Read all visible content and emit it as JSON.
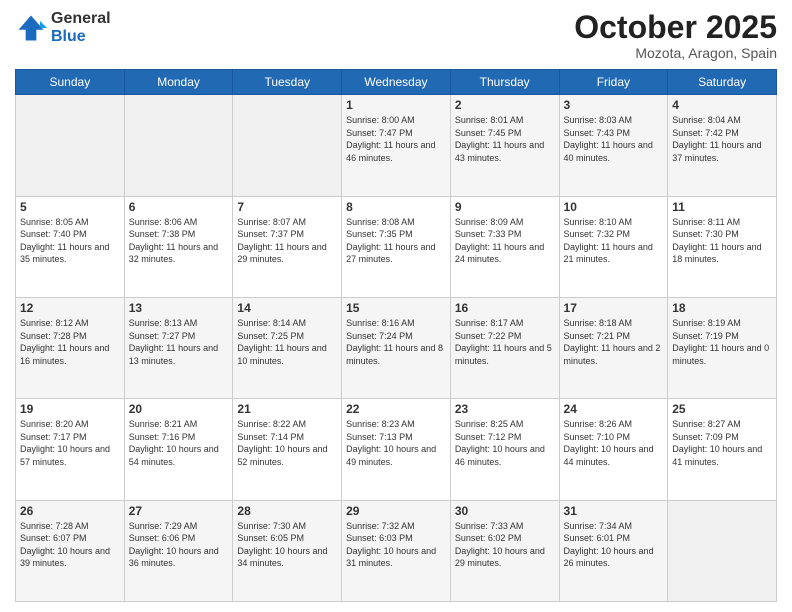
{
  "logo": {
    "general": "General",
    "blue": "Blue"
  },
  "title": "October 2025",
  "subtitle": "Mozota, Aragon, Spain",
  "days_of_week": [
    "Sunday",
    "Monday",
    "Tuesday",
    "Wednesday",
    "Thursday",
    "Friday",
    "Saturday"
  ],
  "weeks": [
    [
      {
        "day": "",
        "info": ""
      },
      {
        "day": "",
        "info": ""
      },
      {
        "day": "",
        "info": ""
      },
      {
        "day": "1",
        "info": "Sunrise: 8:00 AM\nSunset: 7:47 PM\nDaylight: 11 hours and 46 minutes."
      },
      {
        "day": "2",
        "info": "Sunrise: 8:01 AM\nSunset: 7:45 PM\nDaylight: 11 hours and 43 minutes."
      },
      {
        "day": "3",
        "info": "Sunrise: 8:03 AM\nSunset: 7:43 PM\nDaylight: 11 hours and 40 minutes."
      },
      {
        "day": "4",
        "info": "Sunrise: 8:04 AM\nSunset: 7:42 PM\nDaylight: 11 hours and 37 minutes."
      }
    ],
    [
      {
        "day": "5",
        "info": "Sunrise: 8:05 AM\nSunset: 7:40 PM\nDaylight: 11 hours and 35 minutes."
      },
      {
        "day": "6",
        "info": "Sunrise: 8:06 AM\nSunset: 7:38 PM\nDaylight: 11 hours and 32 minutes."
      },
      {
        "day": "7",
        "info": "Sunrise: 8:07 AM\nSunset: 7:37 PM\nDaylight: 11 hours and 29 minutes."
      },
      {
        "day": "8",
        "info": "Sunrise: 8:08 AM\nSunset: 7:35 PM\nDaylight: 11 hours and 27 minutes."
      },
      {
        "day": "9",
        "info": "Sunrise: 8:09 AM\nSunset: 7:33 PM\nDaylight: 11 hours and 24 minutes."
      },
      {
        "day": "10",
        "info": "Sunrise: 8:10 AM\nSunset: 7:32 PM\nDaylight: 11 hours and 21 minutes."
      },
      {
        "day": "11",
        "info": "Sunrise: 8:11 AM\nSunset: 7:30 PM\nDaylight: 11 hours and 18 minutes."
      }
    ],
    [
      {
        "day": "12",
        "info": "Sunrise: 8:12 AM\nSunset: 7:28 PM\nDaylight: 11 hours and 16 minutes."
      },
      {
        "day": "13",
        "info": "Sunrise: 8:13 AM\nSunset: 7:27 PM\nDaylight: 11 hours and 13 minutes."
      },
      {
        "day": "14",
        "info": "Sunrise: 8:14 AM\nSunset: 7:25 PM\nDaylight: 11 hours and 10 minutes."
      },
      {
        "day": "15",
        "info": "Sunrise: 8:16 AM\nSunset: 7:24 PM\nDaylight: 11 hours and 8 minutes."
      },
      {
        "day": "16",
        "info": "Sunrise: 8:17 AM\nSunset: 7:22 PM\nDaylight: 11 hours and 5 minutes."
      },
      {
        "day": "17",
        "info": "Sunrise: 8:18 AM\nSunset: 7:21 PM\nDaylight: 11 hours and 2 minutes."
      },
      {
        "day": "18",
        "info": "Sunrise: 8:19 AM\nSunset: 7:19 PM\nDaylight: 11 hours and 0 minutes."
      }
    ],
    [
      {
        "day": "19",
        "info": "Sunrise: 8:20 AM\nSunset: 7:17 PM\nDaylight: 10 hours and 57 minutes."
      },
      {
        "day": "20",
        "info": "Sunrise: 8:21 AM\nSunset: 7:16 PM\nDaylight: 10 hours and 54 minutes."
      },
      {
        "day": "21",
        "info": "Sunrise: 8:22 AM\nSunset: 7:14 PM\nDaylight: 10 hours and 52 minutes."
      },
      {
        "day": "22",
        "info": "Sunrise: 8:23 AM\nSunset: 7:13 PM\nDaylight: 10 hours and 49 minutes."
      },
      {
        "day": "23",
        "info": "Sunrise: 8:25 AM\nSunset: 7:12 PM\nDaylight: 10 hours and 46 minutes."
      },
      {
        "day": "24",
        "info": "Sunrise: 8:26 AM\nSunset: 7:10 PM\nDaylight: 10 hours and 44 minutes."
      },
      {
        "day": "25",
        "info": "Sunrise: 8:27 AM\nSunset: 7:09 PM\nDaylight: 10 hours and 41 minutes."
      }
    ],
    [
      {
        "day": "26",
        "info": "Sunrise: 7:28 AM\nSunset: 6:07 PM\nDaylight: 10 hours and 39 minutes."
      },
      {
        "day": "27",
        "info": "Sunrise: 7:29 AM\nSunset: 6:06 PM\nDaylight: 10 hours and 36 minutes."
      },
      {
        "day": "28",
        "info": "Sunrise: 7:30 AM\nSunset: 6:05 PM\nDaylight: 10 hours and 34 minutes."
      },
      {
        "day": "29",
        "info": "Sunrise: 7:32 AM\nSunset: 6:03 PM\nDaylight: 10 hours and 31 minutes."
      },
      {
        "day": "30",
        "info": "Sunrise: 7:33 AM\nSunset: 6:02 PM\nDaylight: 10 hours and 29 minutes."
      },
      {
        "day": "31",
        "info": "Sunrise: 7:34 AM\nSunset: 6:01 PM\nDaylight: 10 hours and 26 minutes."
      },
      {
        "day": "",
        "info": ""
      }
    ]
  ]
}
